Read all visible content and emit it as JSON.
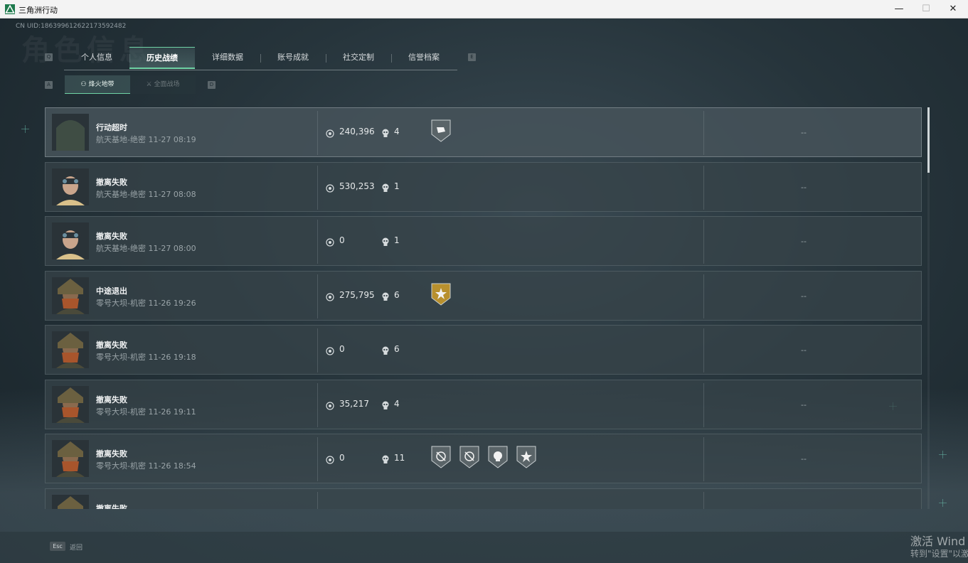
{
  "window": {
    "title": "三角洲行动",
    "min_label": "—",
    "max_label": "☐",
    "close_label": "✕"
  },
  "background_heading": "角色信息",
  "uid": "CN UID:186399612622173592482",
  "key_hints": {
    "prev_tab": "Q",
    "next_tab": "E",
    "prev_sub": "A",
    "next_sub": "D"
  },
  "tabs": [
    {
      "label": "个人信息",
      "active": false
    },
    {
      "label": "历史战绩",
      "active": true
    },
    {
      "label": "详细数据",
      "active": false
    },
    {
      "label": "账号成就",
      "active": false
    },
    {
      "label": "社交定制",
      "active": false
    },
    {
      "label": "信誉档案",
      "active": false
    }
  ],
  "subtabs": [
    {
      "label": "烽火地带",
      "active": true
    },
    {
      "label": "全面战场",
      "active": false
    }
  ],
  "records": [
    {
      "status": "行动超时",
      "detail": "航天基地-绝密 11-27 08:19",
      "value": "240,396",
      "kills": "4",
      "result": "--",
      "avatar": "hooded-operator-icon",
      "badges": [
        "smash-badge-icon"
      ]
    },
    {
      "status": "撤离失败",
      "detail": "航天基地-绝密 11-27 08:08",
      "value": "530,253",
      "kills": "1",
      "result": "--",
      "avatar": "goggles-operator-icon",
      "badges": []
    },
    {
      "status": "撤离失败",
      "detail": "航天基地-绝密 11-27 08:00",
      "value": "0",
      "kills": "1",
      "result": "--",
      "avatar": "goggles-operator-icon",
      "badges": []
    },
    {
      "status": "中途退出",
      "detail": "零号大坝-机密 11-26 19:26",
      "value": "275,795",
      "kills": "6",
      "result": "--",
      "avatar": "armored-operator-icon",
      "badges": [
        "gold-star-badge-icon"
      ]
    },
    {
      "status": "撤离失败",
      "detail": "零号大坝-机密 11-26 19:18",
      "value": "0",
      "kills": "6",
      "result": "--",
      "avatar": "armored-operator-icon",
      "badges": []
    },
    {
      "status": "撤离失败",
      "detail": "零号大坝-机密 11-26 19:11",
      "value": "35,217",
      "kills": "4",
      "result": "--",
      "avatar": "armored-operator-icon",
      "badges": []
    },
    {
      "status": "撤离失败",
      "detail": "零号大坝-机密 11-26 18:54",
      "value": "0",
      "kills": "11",
      "result": "--",
      "avatar": "armored-operator-icon",
      "badges": [
        "crosshair-badge-icon",
        "crosshair-badge-icon",
        "skull-badge-icon",
        "burst-badge-icon"
      ]
    },
    {
      "status": "撤离失败",
      "detail": "",
      "value": "",
      "kills": "",
      "result": "",
      "avatar": "armored-operator-icon",
      "badges": []
    }
  ],
  "footer": {
    "esc_key": "Esc",
    "esc_label": "返回"
  },
  "watermark": {
    "line1": "激活 Wind",
    "line2": "转到\"设置\"以激"
  },
  "colors": {
    "accent": "#6fd3a5",
    "gold_badge": "#b8902e",
    "grey_badge": "#5a6468"
  }
}
